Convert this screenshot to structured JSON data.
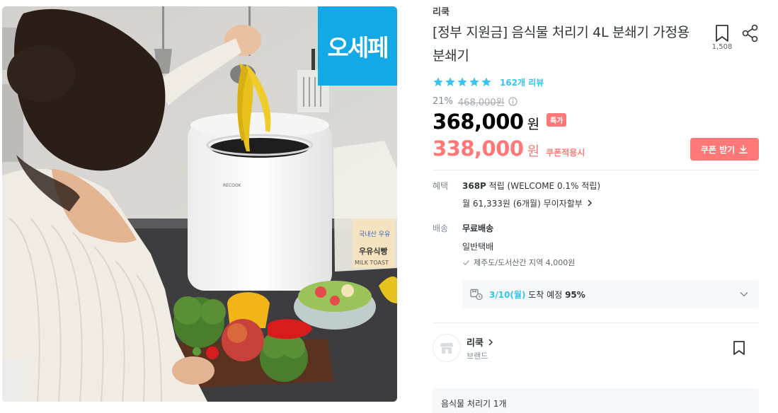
{
  "image": {
    "badge_text": "오세페",
    "badge_color": "#12a9e6",
    "alt_subject": "woman putting banana peel into food waste disposer",
    "device_logo_text": "RECOOK",
    "bag_text_top": "국내산 우유",
    "bag_text_mid": "우유식빵",
    "bag_text_bottom": "MILK TOAST"
  },
  "product": {
    "brand": "리쿡",
    "title": "[정부 지원금] 음식물 처리기 4L 분쇄기 가정용 분쇄기",
    "bookmark_count": "1,508",
    "rating": 5,
    "review_count_label": "162개 리뷰",
    "discount_rate": "21%",
    "original_price": "468,000원",
    "price": "368,000",
    "price_unit": "원",
    "special_badge": "특가",
    "coupon_price": "338,000",
    "coupon_price_unit": "원",
    "coupon_price_label": "쿠폰적용시",
    "coupon_button_label": "쿠폰 받기"
  },
  "benefit": {
    "label": "혜택",
    "point_bold": "368P",
    "point_rest": " 적립 (WELCOME 0.1% 적립)",
    "installment": "월 61,333원 (6개월) 무이자할부"
  },
  "shipping": {
    "label": "배송",
    "free": "무료배송",
    "type": "일반택배",
    "extra": "제주도/도서산간 지역 4,000원",
    "arrival_date": "3/10(월)",
    "arrival_text": " 도착 예정 ",
    "arrival_pct": "95%"
  },
  "brand_card": {
    "name": "리쿡",
    "subtitle": "브랜드"
  },
  "option": {
    "summary": "음식물 처리기 1개"
  },
  "colors": {
    "accent": "#35c5f0",
    "sale": "#ff7777",
    "text": "#2f3438",
    "muted": "#828c94"
  },
  "icons": [
    "bookmark-icon",
    "share-icon",
    "star-icon",
    "info-icon",
    "download-icon",
    "check-icon",
    "truck-icon",
    "chevron-down-icon",
    "store-icon",
    "chevron-right-icon"
  ]
}
